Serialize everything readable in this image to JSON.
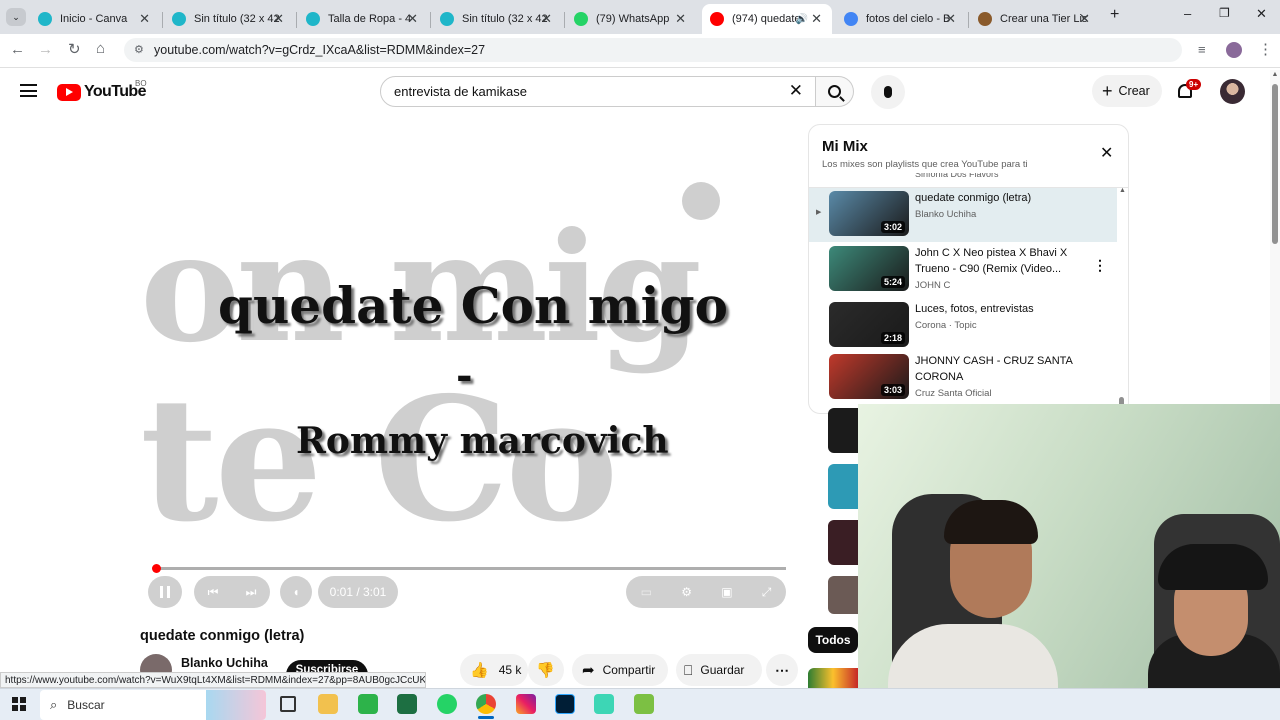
{
  "browser": {
    "tabs": [
      {
        "title": "Inicio - Canva",
        "favicon_color": "#1fb6c9"
      },
      {
        "title": "Sin título (32 x 42",
        "favicon_color": "#1fb6c9"
      },
      {
        "title": "Talla de Ropa - 4",
        "favicon_color": "#1fb6c9"
      },
      {
        "title": "Sin título (32 x 42",
        "favicon_color": "#1fb6c9"
      },
      {
        "title": "(79) WhatsApp",
        "favicon_color": "#25d366"
      },
      {
        "title": "(974) quedate",
        "favicon_color": "#ff0000"
      },
      {
        "title": "fotos del cielo - B",
        "favicon_color": "#4285f4"
      },
      {
        "title": "Crear una Tier List",
        "favicon_color": "#8a5a2b"
      }
    ],
    "new_tab": "+",
    "url": "youtube.com/watch?v=gCrdz_IXcaA&list=RDMM&index=27",
    "status_url": "https://www.youtube.com/watch?v=WuX9tqLt4XM&list=RDMM&index=27&pp=8AUB0gcJCcUK..."
  },
  "youtube": {
    "logo": "YouTube",
    "country": "BO",
    "search_value": "entrevista de kamikase",
    "create_label": "Crear",
    "notif_badge": "9+"
  },
  "video": {
    "lyric_line1": "quedate Con migo",
    "lyric_dash": "-",
    "lyric_line2": "Rommy marcovich",
    "bg_line1": "on mig",
    "bg_line2": "te Co",
    "time": "0:01 / 3:01",
    "progress_fraction": 0.003,
    "title": "quedate conmigo (letra)",
    "channel": "Blanko Uchiha",
    "subscribe": "Suscribirse",
    "likes": "45 k",
    "share": "Compartir",
    "save": "Guardar"
  },
  "playlist": {
    "title": "Mi Mix",
    "subtitle": "Los mixes son playlists que crea YouTube para ti",
    "partial_item": "Sinfonía Dos Flavors",
    "items": [
      {
        "title": "quedate conmigo (letra)",
        "channel": "Blanko Uchiha",
        "duration": "3:02",
        "thumb_color": "#5a8aa8"
      },
      {
        "title": "John C X Neo pistea X Bhavi X Trueno - C90 (Remix (Video...",
        "channel": "JOHN C",
        "duration": "5:24",
        "thumb_color": "#3d8a7a"
      },
      {
        "title": "Luces, fotos, entrevistas",
        "channel": "Corona · Topic",
        "duration": "2:18",
        "thumb_color": "#2b2b2b"
      },
      {
        "title": "JHONNY CASH - CRUZ SANTA CORONA",
        "channel": "Cruz Santa Oficial",
        "duration": "3:03",
        "thumb_color": "#c0392b"
      }
    ],
    "chip_all": "Todos"
  },
  "taskbar": {
    "search_placeholder": "Buscar"
  }
}
